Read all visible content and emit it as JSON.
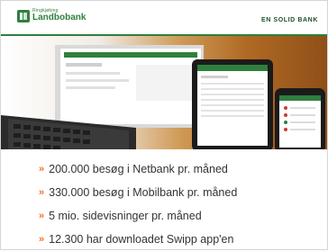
{
  "brand": {
    "small": "Ringkjøbing",
    "name": "Landbobank",
    "tagline": "EN SOLID BANK",
    "accent": "#2f7f3e"
  },
  "bullets": [
    {
      "text": "200.000 besøg i Netbank pr. måned",
      "icon": "double-chevron-right-icon"
    },
    {
      "text": "330.000 besøg i Mobilbank pr. måned",
      "icon": "double-chevron-right-icon"
    },
    {
      "text": "5 mio. sidevisninger pr. måned",
      "icon": "double-chevron-right-icon"
    },
    {
      "text": "12.300 har downloadet Swipp app'en",
      "icon": "double-chevron-right-icon"
    }
  ],
  "colors": {
    "bullet_icon": "#f37021"
  }
}
